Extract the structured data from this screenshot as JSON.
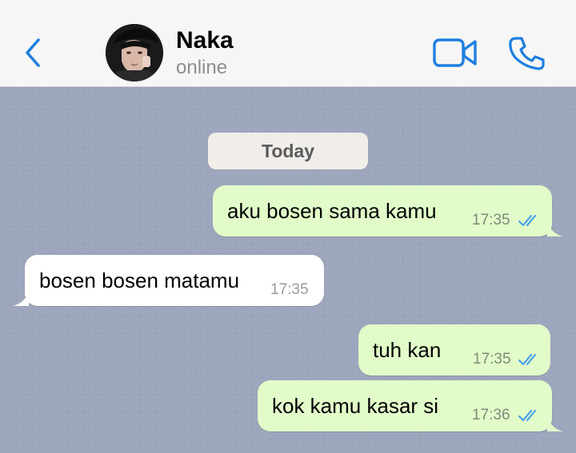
{
  "header": {
    "contact_name": "Naka",
    "contact_status": "online",
    "icons": {
      "back": "chevron-left-icon",
      "video": "video-camera-icon",
      "call": "phone-icon"
    },
    "accent_color": "#1f7fe0"
  },
  "chat": {
    "date_label": "Today",
    "messages": [
      {
        "direction": "outgoing",
        "text": "aku bosen sama kamu",
        "time": "17:35",
        "read": true
      },
      {
        "direction": "incoming",
        "text": "bosen bosen matamu",
        "time": "17:35"
      },
      {
        "direction": "outgoing",
        "text": "tuh kan",
        "time": "17:35",
        "read": true
      },
      {
        "direction": "outgoing",
        "text": "kok kamu kasar si",
        "time": "17:36",
        "read": true
      }
    ],
    "colors": {
      "outgoing_bubble": "#e2fcc9",
      "incoming_bubble": "#ffffff",
      "read_ticks": "#4fa3e8",
      "wallpaper": "#9ea6bd"
    }
  }
}
